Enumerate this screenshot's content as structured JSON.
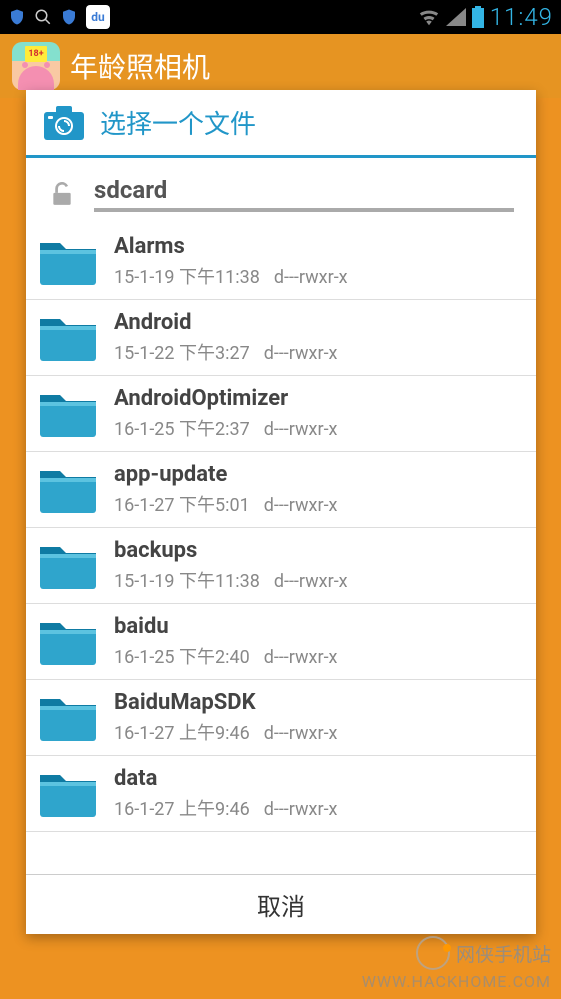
{
  "statusbar": {
    "time": "11:49",
    "du_label": "du"
  },
  "app": {
    "title": "年龄照相机",
    "icon_badge": "18+"
  },
  "dialog": {
    "title": "选择一个文件",
    "location": "sdcard",
    "cancel": "取消"
  },
  "files": [
    {
      "name": "Alarms",
      "time": "15-1-19 下午11:38",
      "perms": "d---rwxr-x"
    },
    {
      "name": "Android",
      "time": "15-1-22 下午3:27",
      "perms": "d---rwxr-x"
    },
    {
      "name": "AndroidOptimizer",
      "time": "16-1-25 下午2:37",
      "perms": "d---rwxr-x"
    },
    {
      "name": "app-update",
      "time": "16-1-27 下午5:01",
      "perms": "d---rwxr-x"
    },
    {
      "name": "backups",
      "time": "15-1-19 下午11:38",
      "perms": "d---rwxr-x"
    },
    {
      "name": "baidu",
      "time": "16-1-25 下午2:40",
      "perms": "d---rwxr-x"
    },
    {
      "name": "BaiduMapSDK",
      "time": "16-1-27 上午9:46",
      "perms": "d---rwxr-x"
    },
    {
      "name": "data",
      "time": "16-1-27 上午9:46",
      "perms": "d---rwxr-x"
    }
  ],
  "watermark": {
    "line1": "网侠手机站",
    "line2": "WWW.HACKHOME.COM"
  }
}
